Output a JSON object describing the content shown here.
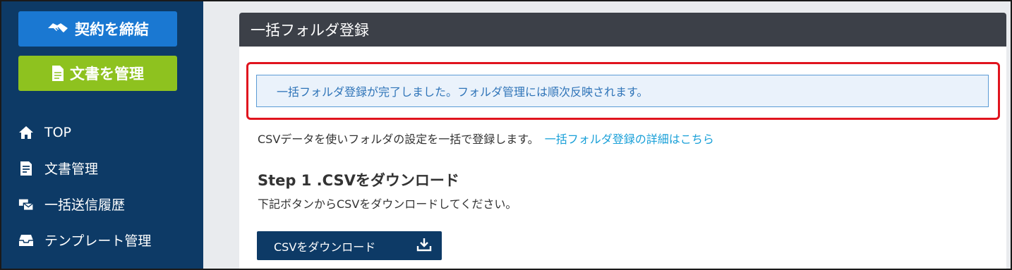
{
  "sidebar": {
    "contract_button": "契約を締結",
    "docs_button": "文書を管理",
    "items": [
      {
        "label": "TOP",
        "icon": "home-icon"
      },
      {
        "label": "文書管理",
        "icon": "document-icon"
      },
      {
        "label": "一括送信履歴",
        "icon": "bulk-send-icon"
      },
      {
        "label": "テンプレート管理",
        "icon": "template-inbox-icon"
      }
    ]
  },
  "main": {
    "header_title": "一括フォルダ登録",
    "alert_message": "一括フォルダ登録が完了しました。フォルダ管理には順次反映されます。",
    "description": "CSVデータを使いフォルダの設定を一括で登録します。",
    "details_link": "一括フォルダ登録の詳細はこちら",
    "step_title": "Step 1 .CSVをダウンロード",
    "step_description": "下記ボタンからCSVをダウンロードしてください。",
    "download_button": "CSVをダウンロード"
  },
  "colors": {
    "sidebar_bg": "#0d3a66",
    "contract_button_bg": "#1a78d2",
    "docs_button_bg": "#8ec21f",
    "header_bg": "#3c4048",
    "alert_text": "#2f74b8",
    "highlight_border": "#e0141e",
    "link": "#1aa0d8"
  }
}
